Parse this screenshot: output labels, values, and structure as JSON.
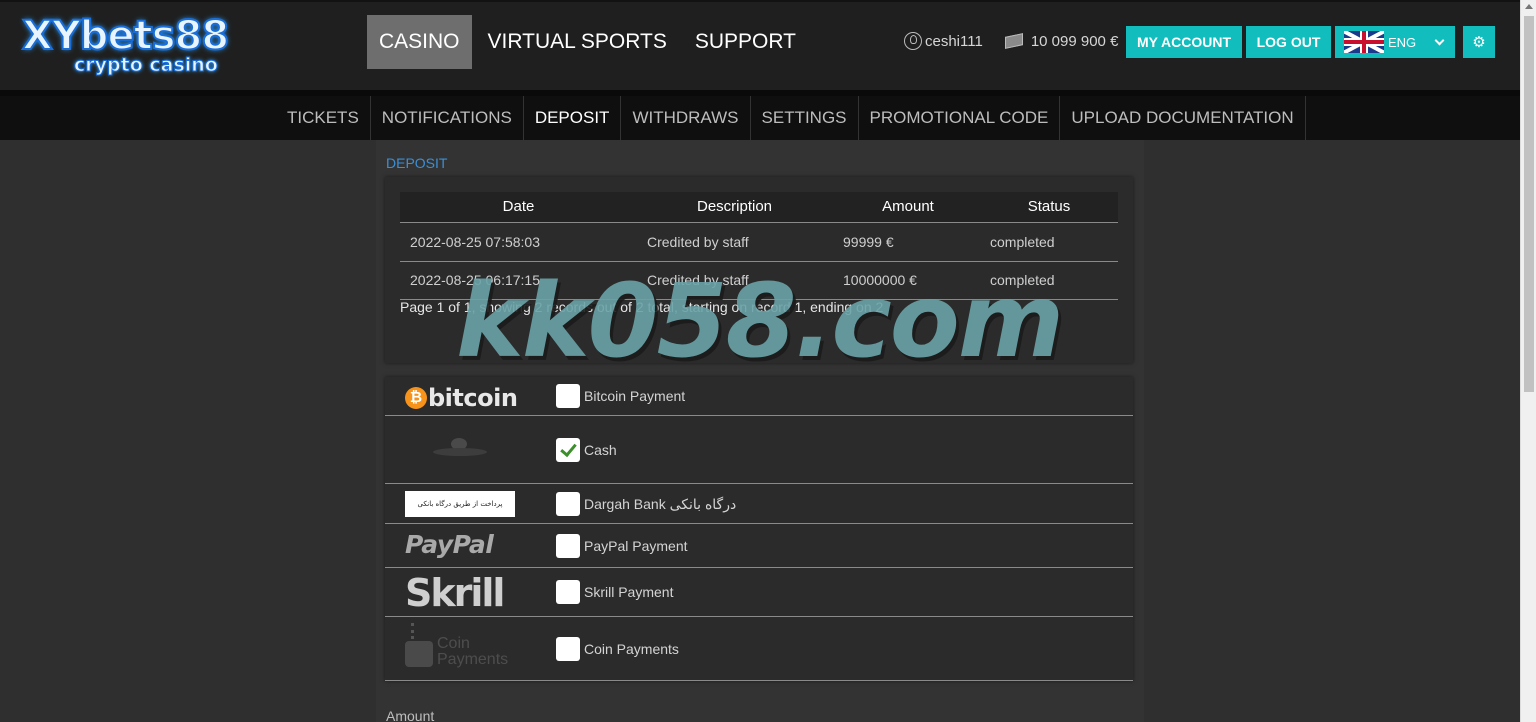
{
  "header": {
    "logo_main": "XYbets88",
    "logo_sub": "crypto casino",
    "nav": [
      {
        "label": "CASINO",
        "active": true
      },
      {
        "label": "VIRTUAL SPORTS",
        "active": false
      },
      {
        "label": "SUPPORT",
        "active": false
      }
    ],
    "username": "ceshi111",
    "balance": "10 099 900 €",
    "my_account_label": "MY ACCOUNT",
    "logout_label": "LOG OUT",
    "language": "ENG",
    "accent_color": "#12bdbd"
  },
  "subnav": [
    {
      "label": "TICKETS",
      "active": false
    },
    {
      "label": "NOTIFICATIONS",
      "active": false
    },
    {
      "label": "DEPOSIT",
      "active": true
    },
    {
      "label": "WITHDRAWS",
      "active": false
    },
    {
      "label": "SETTINGS",
      "active": false
    },
    {
      "label": "PROMOTIONAL CODE",
      "active": false
    },
    {
      "label": "UPLOAD DOCUMENTATION",
      "active": false
    }
  ],
  "deposit": {
    "title": "DEPOSIT",
    "columns": [
      "Date",
      "Description",
      "Amount",
      "Status"
    ],
    "rows": [
      {
        "date": "2022-08-25 07:58:03",
        "description": "Credited by staff",
        "amount": "99999 €",
        "status": "completed"
      },
      {
        "date": "2022-08-25 06:17:15",
        "description": "Credited by staff",
        "amount": "10000000 €",
        "status": "completed"
      }
    ],
    "pager": "Page 1 of 1, showing 2 records out of 2 total, starting on record 1, ending on 2"
  },
  "payments": [
    {
      "logo": "bitcoin",
      "label": "Bitcoin Payment",
      "checked": false
    },
    {
      "logo": "cash",
      "label": "Cash",
      "checked": true
    },
    {
      "logo": "dargah",
      "logo_text": "پرداخت از طریق درگاه بانکی",
      "label": "Dargah Bank درگاه بانکی",
      "checked": false
    },
    {
      "logo": "PayPal",
      "label": "PayPal Payment",
      "checked": false
    },
    {
      "logo": "Skrill",
      "label": "Skrill Payment",
      "checked": false
    },
    {
      "logo": "coinpayments",
      "logo_line1": "Coin",
      "logo_line2": "Payments",
      "label": "Coin Payments",
      "checked": false
    }
  ],
  "amount_label": "Amount",
  "watermark": "kk058.com"
}
